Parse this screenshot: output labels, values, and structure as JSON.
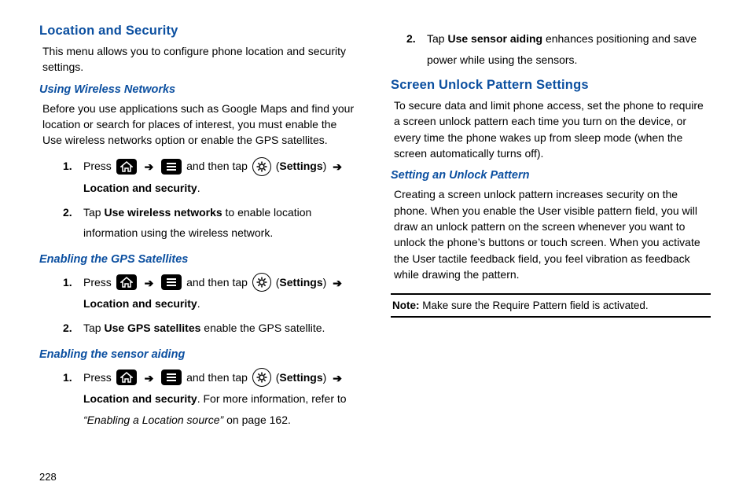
{
  "pageNumber": "228",
  "left": {
    "h2": "Location and Security",
    "intro": "This menu allows you to configure phone location and security settings.",
    "sub1": {
      "title": "Using Wireless Networks",
      "para": "Before you use applications such as Google Maps and find your location or search for places of interest, you must enable the Use wireless networks option or enable the GPS satellites.",
      "step1_press": "Press",
      "step1_andThenTap": "and then tap",
      "step1_settingsLabel": "Settings",
      "step1_bold": "Location and security",
      "step2_a": "Tap ",
      "step2_bold": "Use wireless networks",
      "step2_b": " to enable location information using the wireless network."
    },
    "sub2": {
      "title": "Enabling the GPS Satellites",
      "step1_press": "Press",
      "step1_andThenTap": "and then tap",
      "step1_settingsLabel": "Settings",
      "step1_bold": "Location and security",
      "step2_a": "Tap ",
      "step2_bold": "Use GPS satellites",
      "step2_b": " enable the GPS satellite."
    },
    "sub3": {
      "title": "Enabling the sensor aiding",
      "step1_press": "Press",
      "step1_andThenTap": "and then tap",
      "step1_settingsLabel": "Settings",
      "step1_bold": "Location and security",
      "step1_after": ". For more information, refer to ",
      "step1_italic": "“Enabling a Location source”",
      "step1_tail": "  on page 162."
    }
  },
  "right": {
    "top_step2_a": "Tap ",
    "top_step2_bold": "Use sensor aiding",
    "top_step2_b": " enhances positioning and save power while using the sensors.",
    "h2": "Screen Unlock Pattern Settings",
    "intro": "To secure data and limit phone access, set the phone to require a screen unlock pattern each time you turn on the device, or every time the phone wakes up from sleep mode (when the screen automatically turns off).",
    "sub1": {
      "title": "Setting an Unlock Pattern",
      "para": "Creating a screen unlock pattern increases security on the phone. When you enable the User visible pattern field, you will draw an unlock pattern on the screen whenever you want to unlock the phone’s buttons or touch screen. When you activate the User tactile feedback field, you feel vibration as feedback while drawing the pattern."
    },
    "note_label": "Note:",
    "note_text": " Make sure the Require Pattern field is activated."
  }
}
